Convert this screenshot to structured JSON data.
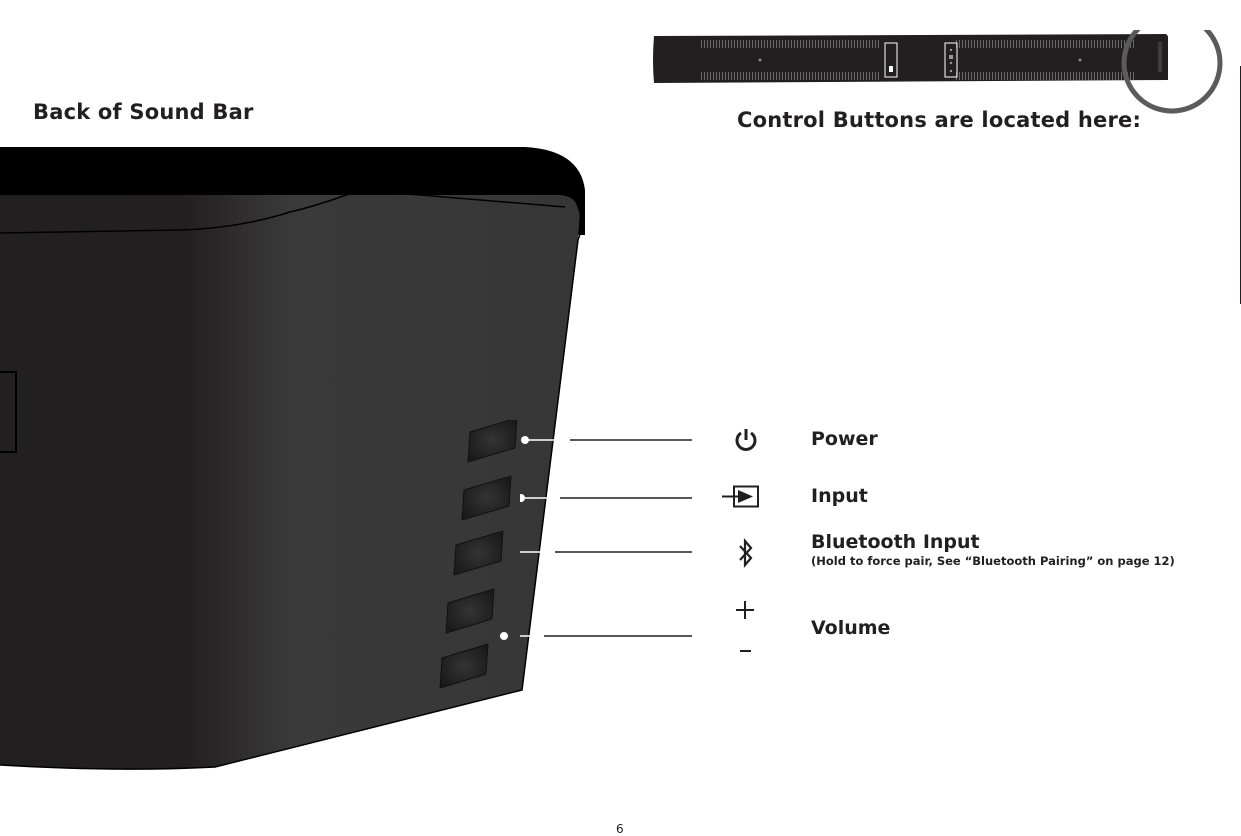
{
  "page": {
    "left_heading": "Back of Sound Bar",
    "right_heading": "Control Buttons are located here:",
    "page_number": "6"
  },
  "overview": {
    "description": "Full sound bar rear view with control button area circled",
    "highlight_color": "#5b5b5b",
    "bar_color": "#231f20"
  },
  "controls": [
    {
      "id": "power",
      "icon": "power-icon",
      "label": "Power",
      "note": ""
    },
    {
      "id": "input",
      "icon": "input-icon",
      "label": "Input",
      "note": ""
    },
    {
      "id": "bluetooth",
      "icon": "bluetooth-icon",
      "label": "Bluetooth Input",
      "note": "(Hold to force pair, See “Bluetooth Pairing” on page 12)"
    },
    {
      "id": "volume",
      "icon": "volume-plus-minus-icon",
      "label": "Volume",
      "note": "",
      "symbols": [
        "+",
        "-"
      ]
    }
  ],
  "colors": {
    "body_dark": "#221f20",
    "body_light": "#3a3a3a",
    "top_edge": "#000000",
    "leader_line": "#231f20",
    "leader_dot": "#ffffff"
  }
}
